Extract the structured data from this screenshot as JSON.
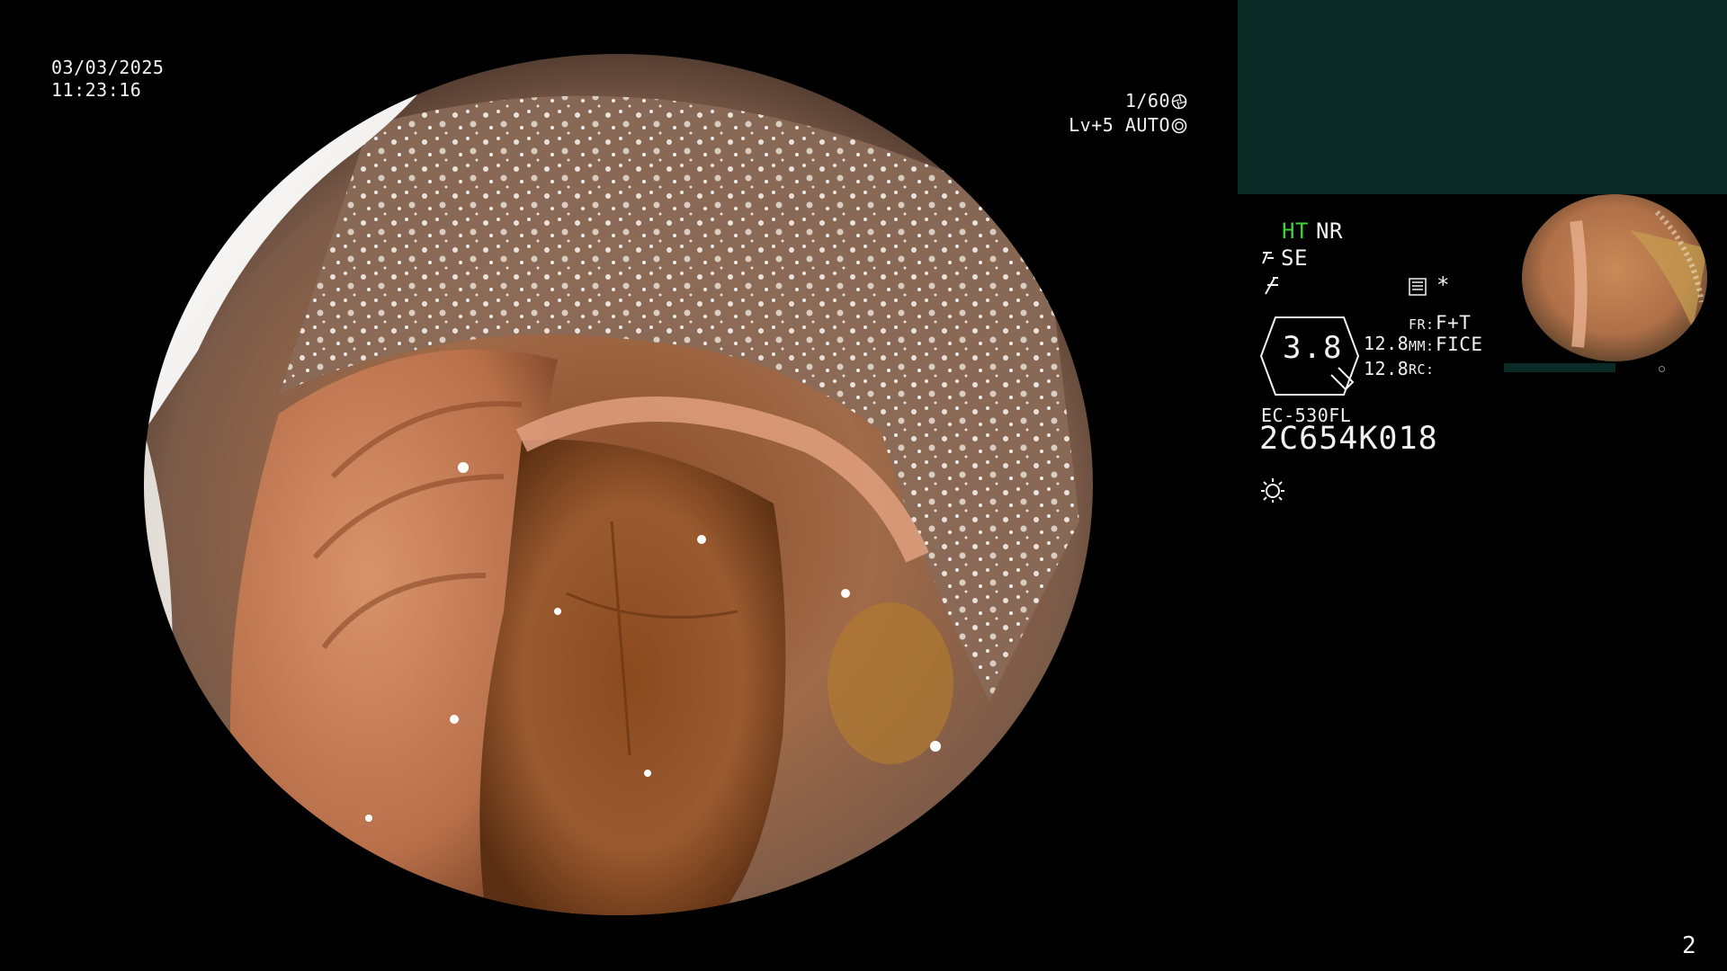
{
  "osd": {
    "date": "03/03/2025",
    "time": "11:23:16",
    "shutter": "1/60",
    "level": "Lv+5 AUTO"
  },
  "panel": {
    "ht": "HT",
    "nr": "NR",
    "se": "SE",
    "zoom": "3.8",
    "value_a": "12.8",
    "value_b": "12.8",
    "fr_key": "FR:",
    "fr_value": "F+T",
    "mm_key": "MM:",
    "mm_value": "FICE",
    "rc_key": "RC:",
    "scope_model": "EC-530FL",
    "scope_serial": "2C654K018",
    "star": "*"
  },
  "page_number": "2",
  "colors": {
    "background": "#000000",
    "ht_green": "#3fd23f",
    "sub_panel": "#0a2a26",
    "osd_text": "#f2f2f2"
  },
  "icons": {
    "shutter": "aperture-icon",
    "level": "auto-iris-icon",
    "se": "structure-enhance-icon",
    "filter": "color-filter-icon",
    "card": "memory-card-icon",
    "light": "light-source-icon"
  }
}
